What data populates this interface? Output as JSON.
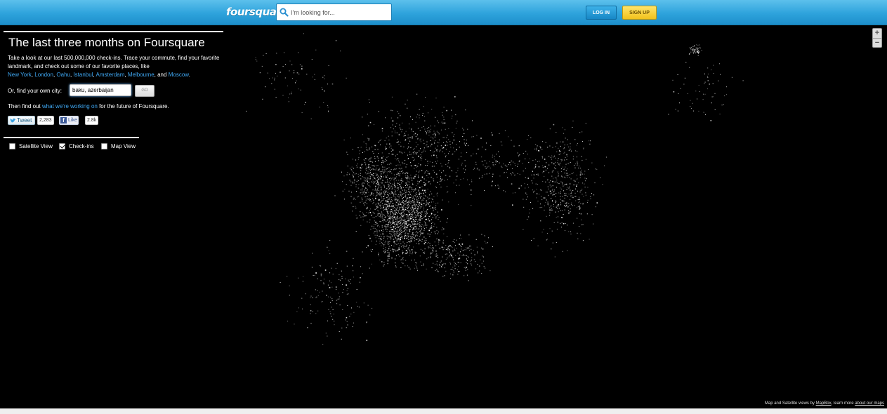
{
  "header": {
    "logo": "foursquare",
    "search_placeholder": "I'm looking for...",
    "login_label": "LOG IN",
    "signup_label": "SIGN UP",
    "colors": {
      "bar": "#2ea3dc",
      "login": "#1787c6",
      "signup": "#f2c21c"
    }
  },
  "panel": {
    "title": "The last three months on Foursquare",
    "desc_intro": "Take a look at our last 500,000,000 check-ins. Trace your commute, find your favorite landmark, and check out some of our favorite places, like",
    "cities": [
      "New York",
      "London",
      "Oahu",
      "Istanbul",
      "Amsterdam",
      "Melbourne",
      "Moscow"
    ],
    "desc_and": "and",
    "find_label": "Or, find your own city:",
    "city_value": "baku, azerbaijan",
    "go_label": "GO",
    "tagline_pre": "Then find out",
    "tagline_link": "what we're working on",
    "tagline_post": "for the future of Foursquare.",
    "tweet_label": "Tweet",
    "tweet_count": "2,283",
    "like_label": "Like",
    "like_count": "2.8k",
    "layers": [
      {
        "label": "Satellite View",
        "checked": false
      },
      {
        "label": "Check-ins",
        "checked": true
      },
      {
        "label": "Map View",
        "checked": false
      }
    ]
  },
  "map": {
    "zoom_in": "+",
    "zoom_out": "−",
    "attribution_pre": "Map and Satellite views by",
    "attribution_link1": "MapBox",
    "attribution_mid": ", learn more",
    "attribution_link2": "about our maps"
  }
}
